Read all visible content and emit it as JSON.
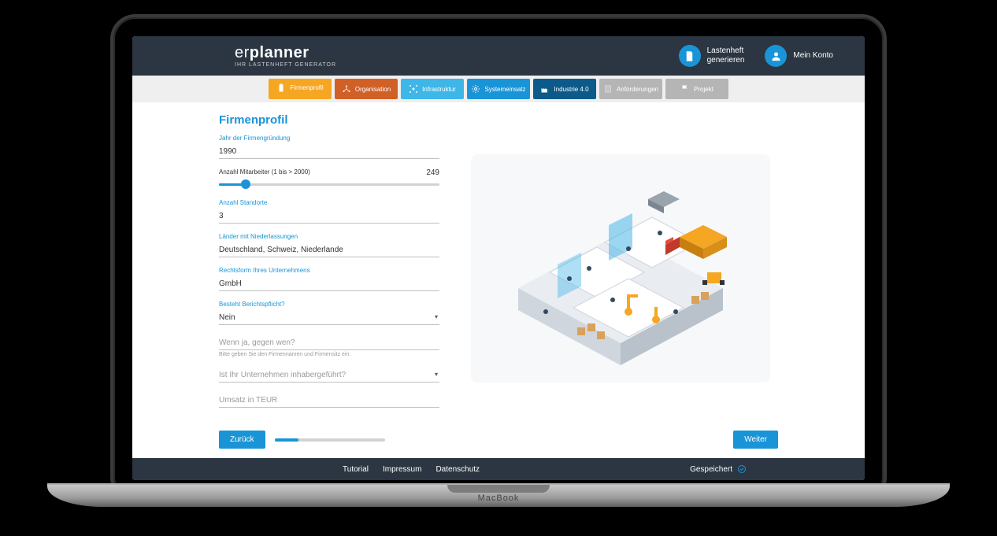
{
  "brand": {
    "name_prefix": "er",
    "name_bold": "planner",
    "tagline": "IHR LASTENHEFT GENERATOR"
  },
  "header": {
    "generate": {
      "line1": "Lastenheft",
      "line2": "generieren"
    },
    "account": "Mein Konto"
  },
  "tabs": [
    {
      "id": "firmenprofil",
      "label": "Firmenprofil",
      "color": "t-orange",
      "active": true
    },
    {
      "id": "organisation",
      "label": "Organisation",
      "color": "t-dorange"
    },
    {
      "id": "infrastruktur",
      "label": "Infrastruktur",
      "color": "t-lblue"
    },
    {
      "id": "systemeinsatz",
      "label": "Systemeinsatz",
      "color": "t-blue"
    },
    {
      "id": "industrie40",
      "label": "Industrie 4.0",
      "color": "t-dblue"
    },
    {
      "id": "anforderungen",
      "label": "Anforderungen",
      "color": "disabled"
    },
    {
      "id": "projekt",
      "label": "Projekt",
      "color": "disabled"
    }
  ],
  "page": {
    "title": "Firmenprofil",
    "fields": {
      "gruendung": {
        "label": "Jahr der Firmengründung",
        "value": "1990"
      },
      "mitarbeiter": {
        "label": "Anzahl Mitarbeiter (1 bis > 2000)",
        "value": "249",
        "min": 1,
        "max": 2000,
        "percent": 12
      },
      "standorte": {
        "label": "Anzahl Standorte",
        "value": "3"
      },
      "laender": {
        "label": "Länder mit Niederlassungen",
        "value": "Deutschland, Schweiz, Niederlande"
      },
      "rechtsform": {
        "label": "Rechtsform Ihres Unternehmens",
        "value": "GmbH"
      },
      "berichtspflicht": {
        "label": "Besteht Berichtspflicht?",
        "value": "Nein"
      },
      "gegenwen": {
        "placeholder": "Wenn ja, gegen wen?",
        "helper": "Bitte geben Sie den Firmennamen und Firmensitz ein."
      },
      "inhaber": {
        "placeholder": "Ist Ihr Unternehmen inhabergeführt?"
      },
      "umsatz": {
        "placeholder": "Umsatz in TEUR"
      }
    },
    "wizard": {
      "back": "Zurück",
      "next": "Weiter",
      "progress_percent": 22
    }
  },
  "footer": {
    "links": [
      "Tutorial",
      "Impressum",
      "Datenschutz"
    ],
    "saved": "Gespeichert"
  },
  "laptop_label": "MacBook"
}
